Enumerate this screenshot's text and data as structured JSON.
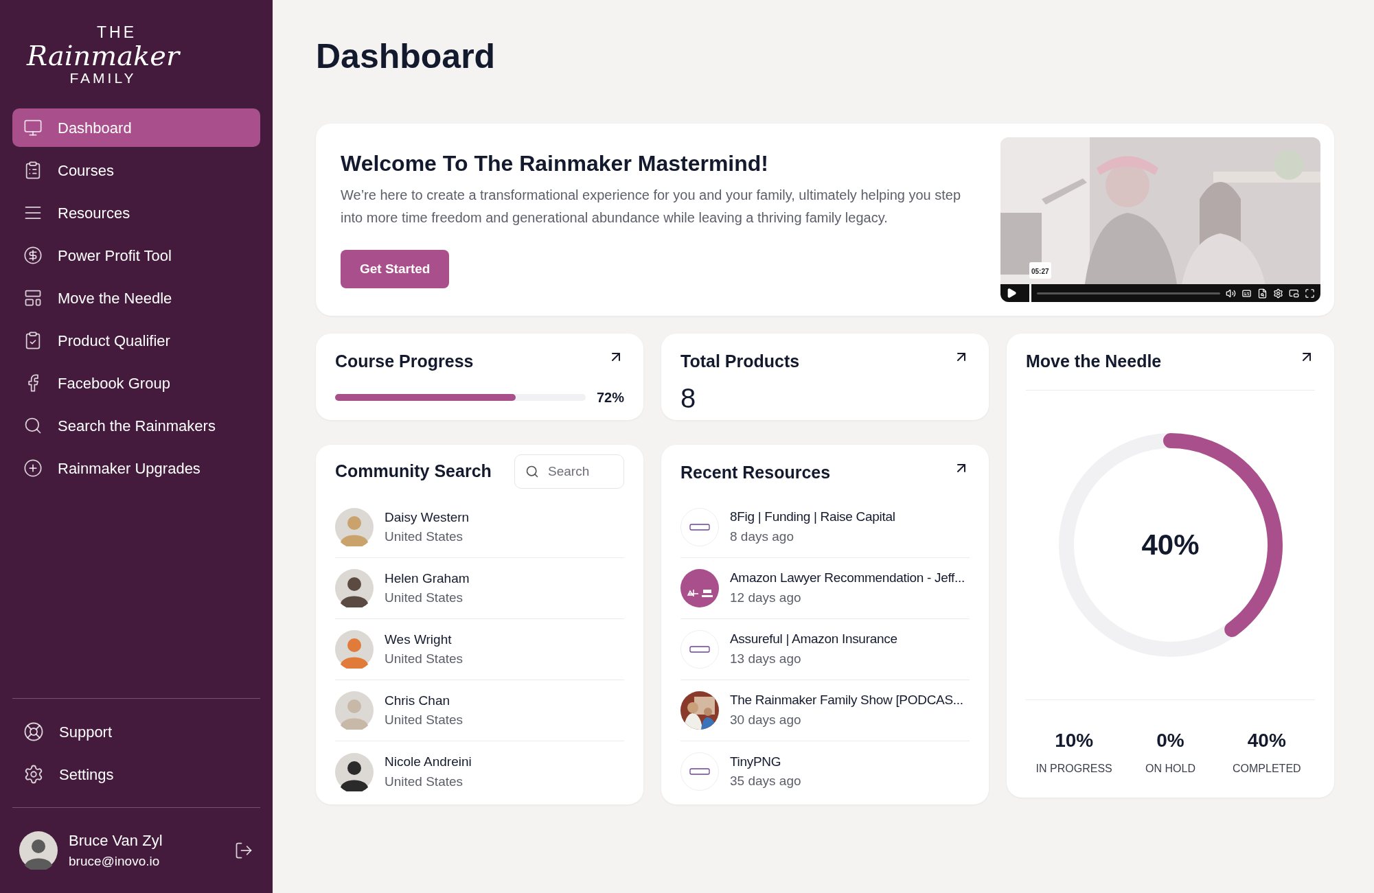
{
  "logo": {
    "top": "THE",
    "main": "Rainmaker",
    "bottom": "FAMILY"
  },
  "sidebar": {
    "items": [
      {
        "label": "Dashboard",
        "selected": true
      },
      {
        "label": "Courses",
        "selected": false
      },
      {
        "label": "Resources",
        "selected": false
      },
      {
        "label": "Power Profit Tool",
        "selected": false
      },
      {
        "label": "Move the Needle",
        "selected": false
      },
      {
        "label": "Product Qualifier",
        "selected": false
      },
      {
        "label": "Facebook Group",
        "selected": false
      },
      {
        "label": "Search the Rainmakers",
        "selected": false
      },
      {
        "label": "Rainmaker Upgrades",
        "selected": false
      }
    ],
    "footer_items": [
      {
        "label": "Support"
      },
      {
        "label": "Settings"
      }
    ],
    "user": {
      "name": "Bruce Van Zyl",
      "email": "bruce@inovo.io"
    }
  },
  "page_title": "Dashboard",
  "welcome": {
    "title": "Welcome To The Rainmaker Mastermind!",
    "text": "We’re here to create a transformational experience for you and your family, ultimately helping you step into more time freedom and generational abundance while leaving a thriving family legacy.",
    "button": "Get Started",
    "video": {
      "time": "05:27"
    }
  },
  "course_progress": {
    "title": "Course Progress",
    "level": 0.72,
    "reading": "72%"
  },
  "total_products": {
    "title": "Total Products",
    "value": "8"
  },
  "move_the_needle": {
    "title": "Move the Needle",
    "level": 0.4,
    "reading": "40%",
    "stats": [
      {
        "value": "10%",
        "label": "IN PROGRESS"
      },
      {
        "value": "0%",
        "label": "ON HOLD"
      },
      {
        "value": "40%",
        "label": "COMPLETED"
      }
    ]
  },
  "community_search": {
    "title": "Community Search",
    "search": {
      "placeholder": "Search"
    },
    "people": [
      {
        "name": "Daisy Western",
        "country": "United States",
        "color": "#c9a36b"
      },
      {
        "name": "Helen Graham",
        "country": "United States",
        "color": "#5a4a42"
      },
      {
        "name": "Wes Wright",
        "country": "United States",
        "color": "#e07b39"
      },
      {
        "name": "Chris Chan",
        "country": "United States",
        "color": "#c8b8a8"
      },
      {
        "name": "Nicole Andreini",
        "country": "United States",
        "color": "#2a2a2a"
      }
    ]
  },
  "recent_resources": {
    "title": "Recent Resources",
    "items": [
      {
        "title": "8Fig | Funding | Raise Capital",
        "age": "8 days ago",
        "kind": "plain"
      },
      {
        "title": "Amazon Lawyer Recommendation - Jeff...",
        "age": "12 days ago",
        "kind": "filled"
      },
      {
        "title": "Assureful | Amazon Insurance",
        "age": "13 days ago",
        "kind": "plain"
      },
      {
        "title": "The Rainmaker Family Show [PODCAS...",
        "age": "30 days ago"
      },
      {
        "title": "TinyPNG",
        "age": "35 days ago",
        "kind": "plain"
      }
    ]
  }
}
